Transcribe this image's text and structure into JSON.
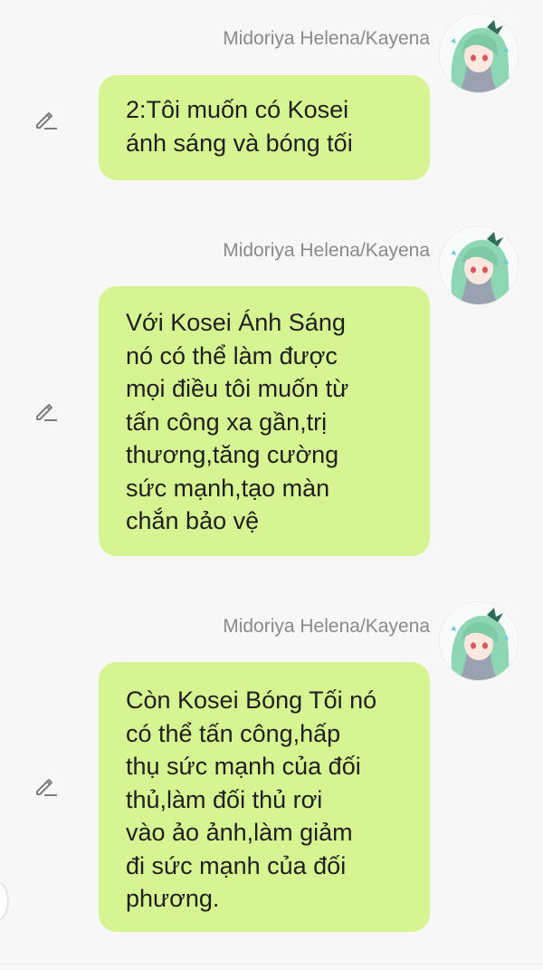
{
  "messages": [
    {
      "sender": "Midoriya Helena/Kayena",
      "text": "2:Tôi muốn có Kosei\nánh sáng và bóng tối",
      "avatar_icon": "anime-girl-green-hair-avatar",
      "edit_icon": "pencil-icon"
    },
    {
      "sender": "Midoriya Helena/Kayena",
      "text": "Với Kosei Ánh Sáng\nnó có thể làm được\nmọi điều tôi muốn từ\ntấn công xa gần,trị\nthương,tăng cường\nsức mạnh,tạo màn\nchắn bảo vệ",
      "avatar_icon": "anime-girl-green-hair-avatar",
      "edit_icon": "pencil-icon"
    },
    {
      "sender": "Midoriya Helena/Kayena",
      "text": "Còn Kosei Bóng Tối nó\ncó thể tấn công,hấp\nthụ sức mạnh của đối\nthủ,làm đối thủ rơi\nvào ảo ảnh,làm giảm\nđi sức mạnh của đối\nphương.",
      "avatar_icon": "anime-girl-green-hair-avatar",
      "edit_icon": "pencil-icon"
    }
  ],
  "colors": {
    "background": "#f7f7f8",
    "bubble": "#d6f592",
    "sender_name": "#8a8a8a",
    "text": "#1f1f1f",
    "icon": "#7d7d7d",
    "avatar_hair": "#8fd6b4"
  }
}
